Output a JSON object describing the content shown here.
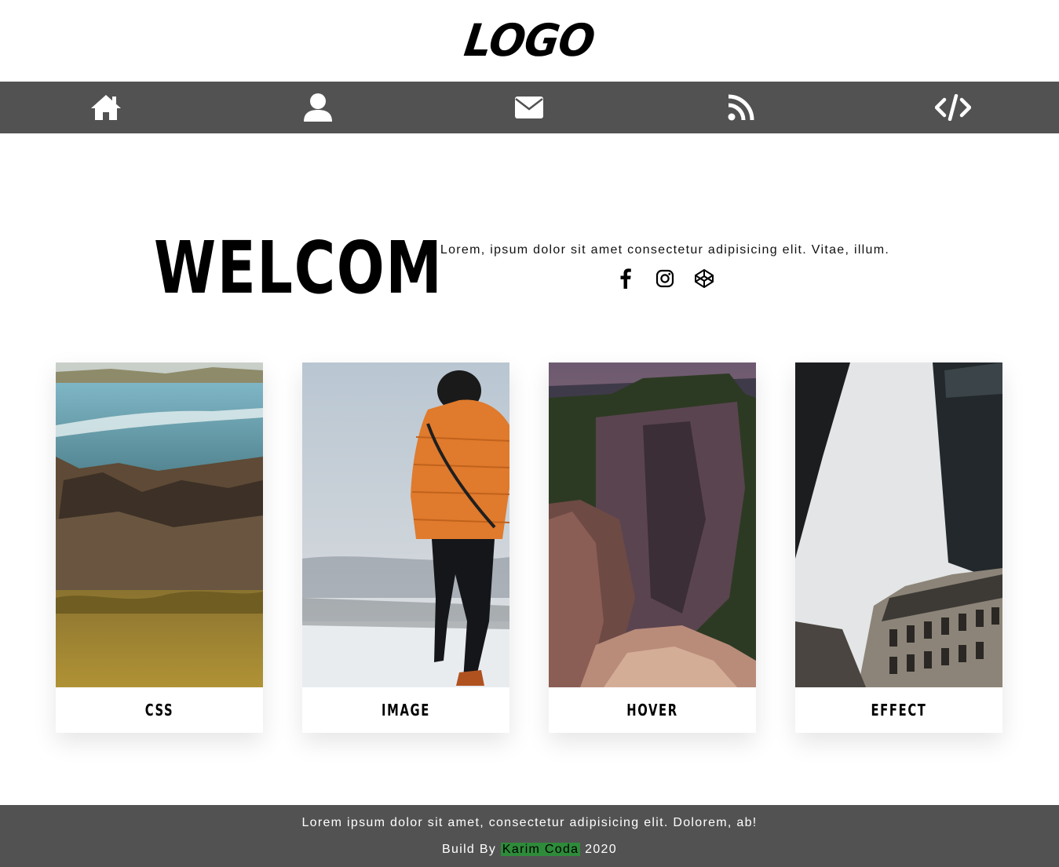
{
  "header": {
    "logo": "LOGO"
  },
  "nav": {
    "items": [
      {
        "icon": "home-icon"
      },
      {
        "icon": "user-icon"
      },
      {
        "icon": "envelope-icon"
      },
      {
        "icon": "rss-icon"
      },
      {
        "icon": "code-icon"
      }
    ]
  },
  "hero": {
    "title": "WELCOM",
    "text": "Lorem, ipsum dolor sit amet consectetur adipisicing elit. Vitae, illum.",
    "socials": [
      {
        "icon": "facebook-icon"
      },
      {
        "icon": "instagram-icon"
      },
      {
        "icon": "codepen-icon"
      }
    ]
  },
  "cards": [
    {
      "label": "CSS",
      "image": "coast-rocks-grass-photo"
    },
    {
      "label": "IMAGE",
      "image": "person-orange-jacket-snow-photo"
    },
    {
      "label": "HOVER",
      "image": "canyon-cliffs-photo"
    },
    {
      "label": "EFFECT",
      "image": "buildings-skyline-photo"
    }
  ],
  "footer": {
    "text": "Lorem ipsum dolor sit amet, consectetur adipisicing elit. Dolorem, ab!",
    "credit_prefix": "Build By",
    "author": "Karim Coda",
    "year": "2020"
  },
  "colors": {
    "nav_background": "#525252",
    "footer_background": "#525252",
    "author_highlight": "#2e8b3a"
  }
}
